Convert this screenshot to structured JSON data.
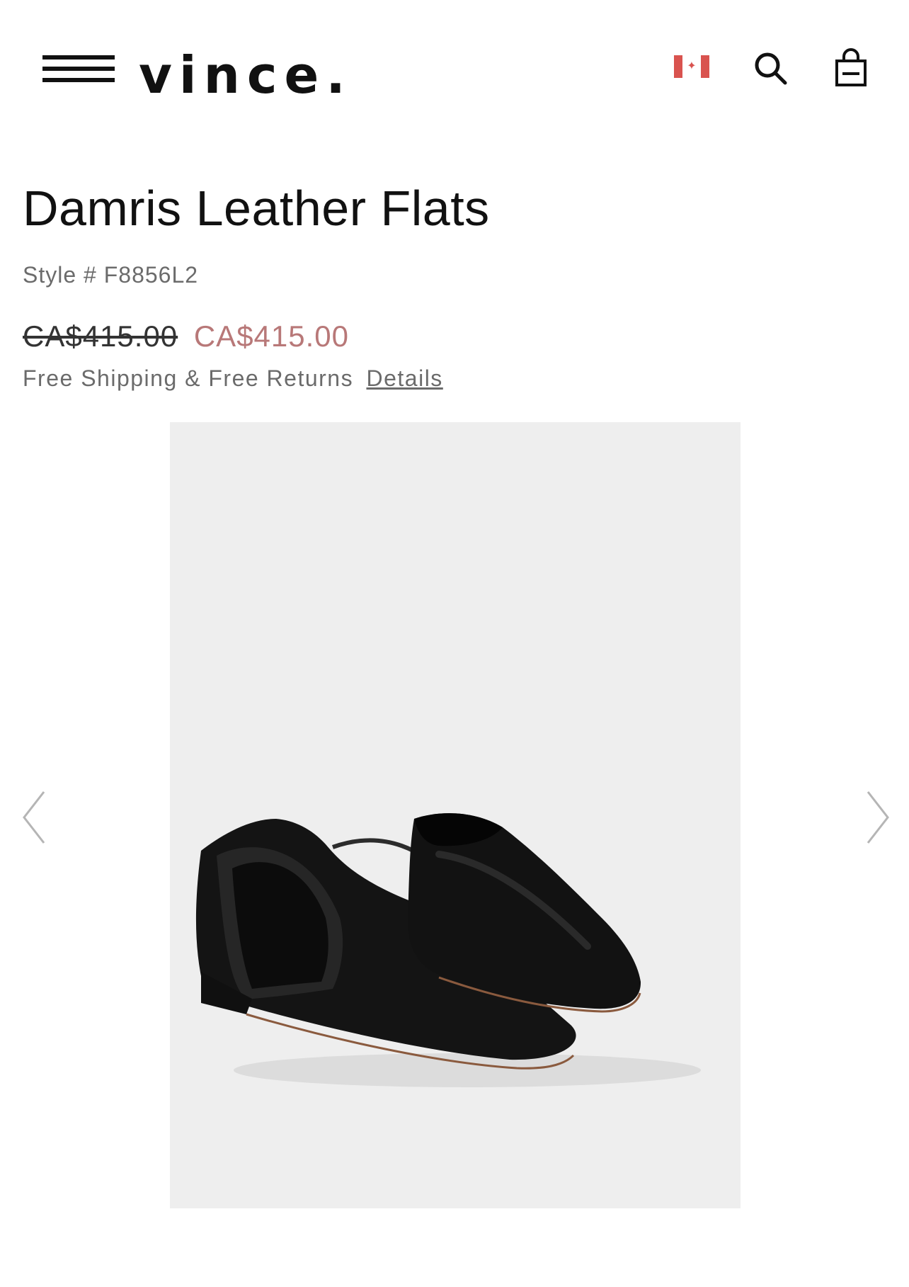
{
  "header": {
    "brand": "VINCE.",
    "icons": {
      "menu": "hamburger-menu-icon",
      "flag": "canada-flag-icon",
      "search": "search-icon",
      "bag": "shopping-bag-icon"
    }
  },
  "product": {
    "title": "Damris Leather Flats",
    "style": "Style # F8856L2",
    "price_original": "CA$415.00",
    "price_sale": "CA$415.00",
    "shipping_text": "Free Shipping & Free Returns",
    "details_link": "Details"
  },
  "gallery": {
    "prev_icon": "chevron-left-icon",
    "next_icon": "chevron-right-icon"
  },
  "colors": {
    "text": "#111111",
    "muted": "#6b6b6b",
    "sale": "#b87878",
    "gallery_bg": "#eeeeee",
    "flag_red": "#d9534f"
  }
}
